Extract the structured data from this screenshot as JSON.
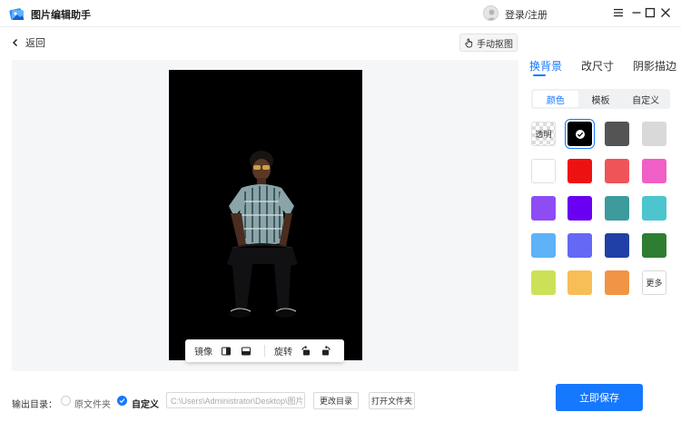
{
  "app": {
    "title": "图片编辑助手"
  },
  "header": {
    "login_text": "登录/注册"
  },
  "toolbar": {
    "back_label": "返回",
    "manual_cutout_label": "手动抠图"
  },
  "image_toolbar": {
    "mirror_label": "镜像",
    "rotate_label": "旋转"
  },
  "right_panel": {
    "tabs": [
      {
        "label": "换背景",
        "active": true
      },
      {
        "label": "改尺寸",
        "active": false
      },
      {
        "label": "阴影描边",
        "active": false
      }
    ],
    "segments": [
      {
        "label": "颜色",
        "active": true
      },
      {
        "label": "模板",
        "active": false
      },
      {
        "label": "自定义",
        "active": false
      }
    ],
    "transparent_label": "透明",
    "more_label": "更多",
    "swatches": [
      "transparent",
      "#000000",
      "#545454",
      "#d9d9d9",
      "#ffffff",
      "#ee1111",
      "#ef5459",
      "#f05fc5",
      "#8e4cf5",
      "#6a00f2",
      "#3d9a9d",
      "#4cc5cf",
      "#5eb2f7",
      "#6468f4",
      "#2040a8",
      "#2f7d31",
      "#cde158",
      "#f7bd57",
      "#f29445",
      "more"
    ],
    "selected_swatch": "#000000"
  },
  "bottom": {
    "output_label": "输出目录：",
    "original_folder_label": "原文件夹",
    "custom_label": "自定义",
    "path_value": "C:\\Users\\Administrator\\Desktop\\图片编辑",
    "change_dir_label": "更改目录",
    "open_folder_label": "打开文件夹",
    "save_label": "立即保存"
  },
  "colors": {
    "accent": "#1677ff",
    "canvas_bg": "#f5f6f8"
  }
}
